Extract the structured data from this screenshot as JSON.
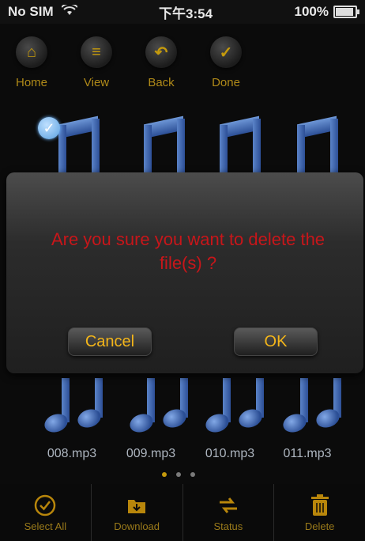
{
  "status_bar": {
    "carrier": "No SIM",
    "time": "下午3:54",
    "battery": "100%",
    "battery_level": 1.0
  },
  "toolbar": {
    "items": [
      {
        "label": "Home",
        "icon": "home-icon"
      },
      {
        "label": "View",
        "icon": "list-icon"
      },
      {
        "label": "Back",
        "icon": "back-arrow-icon"
      },
      {
        "label": "Done",
        "icon": "check-icon"
      }
    ]
  },
  "dialog": {
    "message": "Are you sure you want to delete the file(s) ?",
    "cancel_label": "Cancel",
    "ok_label": "OK"
  },
  "files": [
    {
      "name": "008.mp3"
    },
    {
      "name": "009.mp3"
    },
    {
      "name": "010.mp3"
    },
    {
      "name": "011.mp3"
    }
  ],
  "pager": {
    "pages": 3,
    "current": 1
  },
  "bottom_bar": {
    "items": [
      {
        "label": "Select All",
        "icon": "select-all-icon"
      },
      {
        "label": "Download",
        "icon": "download-folder-icon"
      },
      {
        "label": "Status",
        "icon": "status-icon"
      },
      {
        "label": "Delete",
        "icon": "trash-icon"
      }
    ]
  },
  "colors": {
    "accent": "#c59a0c",
    "alert": "#c8161a",
    "note_blue": "#3a5fa8"
  }
}
